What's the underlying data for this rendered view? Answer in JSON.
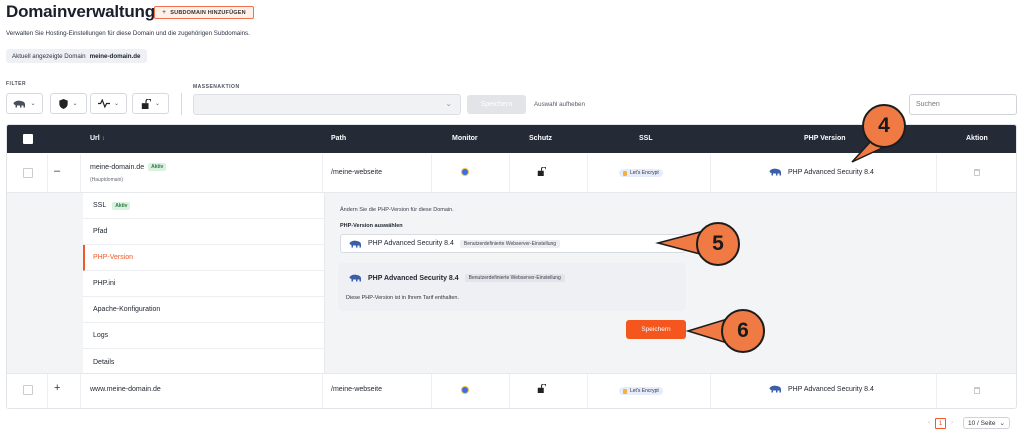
{
  "header": {
    "title": "Domainverwaltung",
    "add_subdomain_label": "SUBDOMAIN HINZUFÜGEN",
    "subtitle": "Verwalten Sie Hosting-Einstellungen für diese Domain und die zugehörigen Subdomains.",
    "current_domain_label": "Aktuell angezeigte Domain",
    "current_domain_value": "meine-domain.de"
  },
  "filters": {
    "label": "FILTER",
    "buttons": [
      "php-filter",
      "shield-filter",
      "monitor-filter",
      "lock-filter"
    ]
  },
  "mass_action": {
    "label": "MASSENAKTION",
    "selected": "",
    "save_label": "Speichern",
    "clear_label": "Auswahl aufheben"
  },
  "search": {
    "placeholder": "Suchen"
  },
  "table": {
    "columns": {
      "url": "Url",
      "path": "Path",
      "monitor": "Monitor",
      "protection": "Schutz",
      "ssl": "SSL",
      "php": "PHP Version",
      "action": "Aktion"
    },
    "rows": [
      {
        "domain": "meine-domain.de",
        "status": "Aktiv",
        "note": "(Hauptdomain)",
        "path": "/meine-webseite",
        "ssl": "Let's Encrypt",
        "php": "PHP Advanced Security 8.4",
        "expanded": true
      },
      {
        "domain": "www.meine-domain.de",
        "path": "/meine-webseite",
        "ssl": "Let's Encrypt",
        "php": "PHP Advanced Security 8.4",
        "expanded": false
      }
    ]
  },
  "detail_nav": {
    "items": [
      {
        "label": "SSL",
        "badge": "Aktiv"
      },
      {
        "label": "Pfad"
      },
      {
        "label": "PHP-Version",
        "active": true
      },
      {
        "label": "PHP.ini"
      },
      {
        "label": "Apache-Konfiguration"
      },
      {
        "label": "Logs"
      },
      {
        "label": "Details"
      }
    ]
  },
  "php_panel": {
    "description": "Ändern Sie die PHP-Version für diese Domain.",
    "select_label": "PHP-Version auswählen",
    "selected_version": "PHP Advanced Security 8.4",
    "selected_badge": "Benutzerdefinierte Webserver-Einstellung",
    "info_title": "PHP Advanced Security 8.4",
    "info_badge": "Benutzerdefinierte Webserver-Einstellung",
    "info_text": "Diese PHP-Version ist in Ihrem Tarif enthalten.",
    "save_label": "Speichern"
  },
  "pagination": {
    "current_page": "1",
    "per_page": "10 / Seite"
  },
  "callouts": [
    "4",
    "5",
    "6"
  ],
  "colors": {
    "accent": "#f4561e",
    "header_dark": "#252a37",
    "callout_fill": "#f07a44",
    "badge_green": "#d8f2df"
  }
}
